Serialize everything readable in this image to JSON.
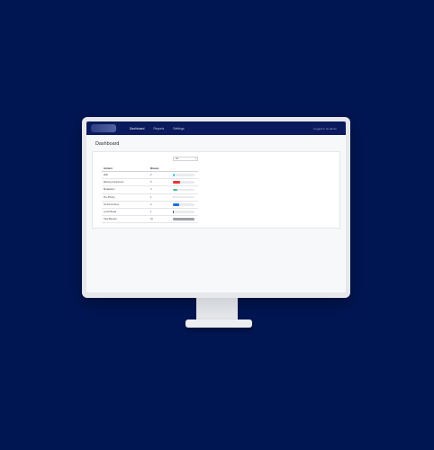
{
  "nav": {
    "links": [
      "Dashboard",
      "Reports",
      "Settings"
    ],
    "user": "Logged in as admin"
  },
  "page": {
    "title": "Dashboard"
  },
  "filter": {
    "value": "All"
  },
  "table": {
    "headers": [
      "Incident",
      "Minutes"
    ],
    "rows": [
      {
        "label": "Wait",
        "value": "2",
        "progress": 0.1,
        "color": "#3fc3ee"
      },
      {
        "label": "Missing Component",
        "value": "5",
        "progress": 0.35,
        "color": "#e53935"
      },
      {
        "label": "Breakdown",
        "value": "3",
        "progress": 0.2,
        "color": "#4fc38b"
      },
      {
        "label": "Pre-Priority",
        "value": "1",
        "progress": 0.05,
        "color": "#c9ccd3"
      },
      {
        "label": "Technical Issue",
        "value": "4",
        "progress": 0.3,
        "color": "#1f6fe0"
      },
      {
        "label": "Lunch Break",
        "value": "1",
        "progress": 0.05,
        "color": "#3a3f4a"
      },
      {
        "label": "Total Minutes",
        "value": "16",
        "progress": 1.0,
        "color": "#9da1a9"
      }
    ]
  }
}
